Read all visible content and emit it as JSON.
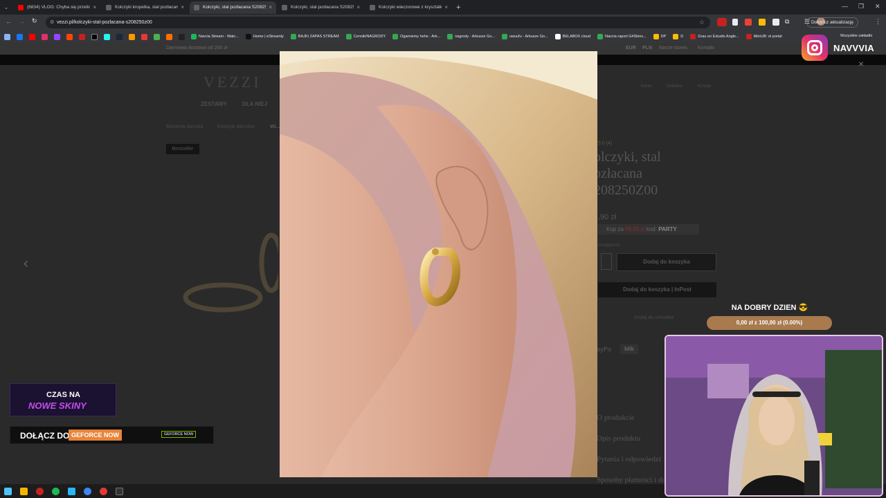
{
  "browser": {
    "tabs": [
      {
        "title": "(6834) VLOG: Chyba się przeliczył...",
        "favicon_color": "#ff0000",
        "active": false
      },
      {
        "title": "Kolczyki kropelka, stal pozłacana S...",
        "favicon_color": "#5f6368",
        "active": false
      },
      {
        "title": "Kolczyki, stal pozłacana S208250Z0...",
        "favicon_color": "#5f6368",
        "active": true
      },
      {
        "title": "Kolczyki, stal pozłacana S208250Z0...",
        "favicon_color": "#5f6368",
        "active": false
      },
      {
        "title": "Kolczyki wieczorowe z kryształkami...",
        "favicon_color": "#5f6368",
        "active": false
      }
    ],
    "new_tab": "+",
    "url": "vezzi.pl/kolczyki-stal-pozlacana-s208250z00",
    "update_button": "Dokończ aktualizację",
    "bookmarks": [
      {
        "label": "Navcia Stream - Watc...",
        "color": "#1db954"
      },
      {
        "label": "Home | eStreamly",
        "color": "#111111"
      },
      {
        "label": "BAJKI ZAPAS STREAM",
        "color": "#34a853"
      },
      {
        "label": "Cennik/NAGRODY",
        "color": "#34a853"
      },
      {
        "label": "Ogarniemy hehe - Ark...",
        "color": "#34a853"
      },
      {
        "label": "nagrody - Arkusze Go...",
        "color": "#34a853"
      },
      {
        "label": "uwuufu - Arkusze Go...",
        "color": "#34a853"
      },
      {
        "label": "BELABOX cloud",
        "color": "#ffffff"
      },
      {
        "label": "Navcia raport G4Skins...",
        "color": "#34a853"
      },
      {
        "label": "DP",
        "color": "#fbbc04"
      },
      {
        "label": "D",
        "color": "#fbbc04"
      },
      {
        "label": "Grau en Estudis Angle...",
        "color": "#c5221f"
      },
      {
        "label": "MönUB: el portal",
        "color": "#c5221f"
      }
    ],
    "all_bookmarks": "Wszystkie zakładki"
  },
  "site": {
    "promo_text": "Darmowa dostawa od 200 zł",
    "currency_options": [
      "EUR",
      "PLN"
    ],
    "top_links": [
      "Nasze stores",
      "Kontakt"
    ],
    "logo": "VEZZI",
    "nav": [
      "ZESTAWY",
      "DLA NIEJ"
    ],
    "header_icons": [
      "Konto",
      "Ulubione",
      "Koszyk"
    ],
    "breadcrumb": [
      "Biżuteria damska",
      "Kolczyki damskie",
      "Wi..."
    ],
    "bestseller_badge": "Bestseller",
    "rating": "5.0 (4)",
    "product_title_lines": [
      "olczyki, stal",
      "ozłacana",
      "208250Z00"
    ],
    "price": ",90 zł",
    "promo_price_prefix": "Kup za",
    "promo_price": "69,93 zł",
    "promo_code_label": "kod:",
    "promo_code": "PARTY",
    "availability": "Dostępność",
    "add_to_cart": "Dodaj do koszyka",
    "add_to_cart_inpost": "Dodaj do koszyka  | InPost",
    "store_pickup": "Dodaj do schowka",
    "payment_label": "ayPo",
    "payment_blik": "blik",
    "sections": [
      "O produkcie",
      "Opis produktu",
      "Pytania i odpowiedzi",
      "Sposoby płatności i dos..."
    ]
  },
  "overlay": {
    "instagram_handle": "NAVVVIA",
    "goal_title": "NA DOBRY DZIEN 😎",
    "goal_progress": "0,00 zł z 100,00 zł (0.00%)",
    "goal_fraction": 0.0,
    "promo_skiny_line1": "CZAS NA",
    "promo_skiny_line2": "NOWE SKINY",
    "geforce_text": "DOŁĄCZ DO",
    "geforce_badge": "GEFORCE NOW",
    "geforce_logo_text": "GEFORCE NOW"
  },
  "lightbox": {
    "close_symbol": "×",
    "prev_arrow": "‹"
  }
}
